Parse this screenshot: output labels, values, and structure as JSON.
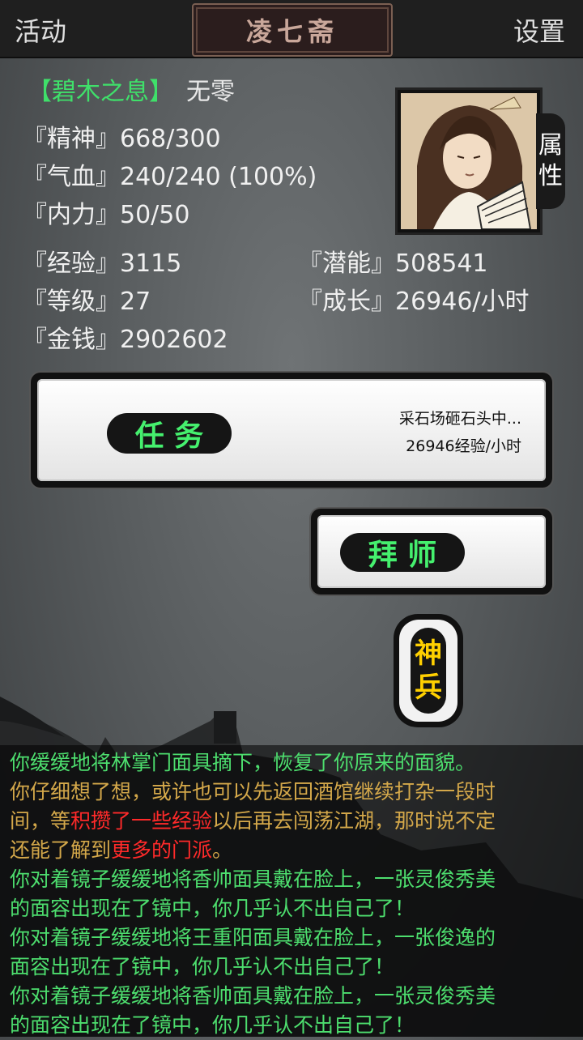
{
  "header": {
    "left_button": "活动",
    "title": "凌七斋",
    "right_button": "设置"
  },
  "character": {
    "faction": "【碧木之息】",
    "name": "无零",
    "attributes_tab": [
      "属",
      "性"
    ],
    "stats": {
      "spirit": "『精神』668/300",
      "health": "『气血』240/240 (100%)",
      "inner_force": "『内力』50/50",
      "experience": "『经验』3115",
      "potential": "『潜能』508541",
      "level": "『等级』27",
      "growth": "『成长』26946/小时",
      "money": "『金钱』2902602"
    }
  },
  "task": {
    "label": "任 务",
    "status_line1": "采石场砸石头中...",
    "status_line2": "26946经验/小时"
  },
  "mentor": {
    "label": "拜 师"
  },
  "weapon": {
    "chars": [
      "神",
      "兵"
    ]
  },
  "log": [
    {
      "color": "green",
      "text": "你缓缓地将林掌门面具摘下，恢复了你原来的面貌。"
    },
    {
      "color": "gold",
      "text": "你仔细想了想，或许也可以先返回酒馆继续打杂一段时"
    },
    {
      "color": "gold",
      "segments": [
        "间，等",
        "积攒了一些经验",
        "以后再去闯荡江湖，那时说不定"
      ]
    },
    {
      "color": "gold",
      "segments": [
        "还能了解到",
        "更多的门派",
        "。"
      ]
    },
    {
      "color": "green",
      "text": "你对着镜子缓缓地将香帅面具戴在脸上，一张灵俊秀美"
    },
    {
      "color": "green",
      "text": "的面容出现在了镜中，你几乎认不出自己了！"
    },
    {
      "color": "green",
      "text": "你对着镜子缓缓地将王重阳面具戴在脸上，一张俊逸的"
    },
    {
      "color": "green",
      "text": "面容出现在了镜中，你几乎认不出自己了！"
    },
    {
      "color": "green",
      "text": "你对着镜子缓缓地将香帅面具戴在脸上，一张灵俊秀美"
    },
    {
      "color": "green",
      "text": "的面容出现在了镜中，你几乎认不出自己了！"
    }
  ],
  "colors": {
    "green_text": "#4dde6e",
    "gold_text": "#d4a84a",
    "red_highlight": "#ff2a2a",
    "button_label_green": "#45f06e",
    "weapon_label_yellow": "#ffd000"
  }
}
